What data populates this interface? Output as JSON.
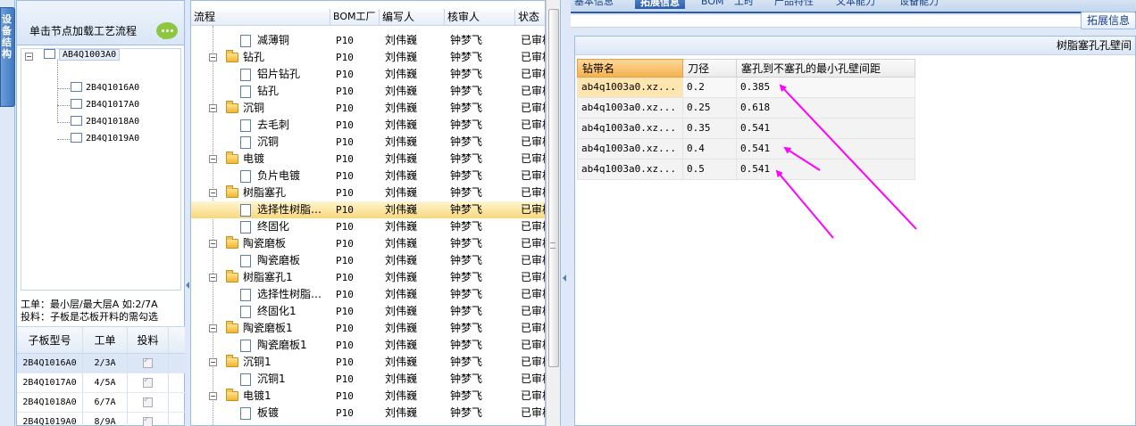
{
  "left_tab": {
    "label": "设备结构"
  },
  "left_panel": {
    "header": "单击节点加载工艺流程",
    "tree": {
      "root": "AB4Q1003A0",
      "children": [
        "2B4Q1016A0",
        "2B4Q1017A0",
        "2B4Q1018A0",
        "2B4Q1019A0"
      ]
    },
    "info_line1": "工单：最小层/最大层A 如:2/7A",
    "info_line2": "投料：子板是芯板开料的需勾选",
    "sub_grid": {
      "headers": [
        "子板型号",
        "工单",
        "投料"
      ],
      "rows": [
        {
          "model": "2B4Q1016A0",
          "order": "2/3A"
        },
        {
          "model": "2B4Q1017A0",
          "order": "4/5A"
        },
        {
          "model": "2B4Q1018A0",
          "order": "6/7A"
        },
        {
          "model": "2B4Q1019A0",
          "order": "8/9A"
        }
      ]
    }
  },
  "process_grid": {
    "headers": [
      "流程",
      "BOM工厂",
      "编写人",
      "核审人",
      "状态"
    ],
    "rows": [
      {
        "name": "减薄铜",
        "level": 2,
        "bom": "P10",
        "writer": "刘伟巍",
        "reviewer": "钟梦飞",
        "status": "已审核"
      },
      {
        "name": "钻孔",
        "level": 1,
        "bom": "P10",
        "writer": "刘伟巍",
        "reviewer": "钟梦飞",
        "status": "已审核"
      },
      {
        "name": "铝片钻孔",
        "level": 2,
        "bom": "P10",
        "writer": "刘伟巍",
        "reviewer": "钟梦飞",
        "status": "已审核"
      },
      {
        "name": "钻孔",
        "level": 2,
        "bom": "P10",
        "writer": "刘伟巍",
        "reviewer": "钟梦飞",
        "status": "已审核"
      },
      {
        "name": "沉铜",
        "level": 1,
        "bom": "P10",
        "writer": "刘伟巍",
        "reviewer": "钟梦飞",
        "status": "已审核"
      },
      {
        "name": "去毛刺",
        "level": 2,
        "bom": "P10",
        "writer": "刘伟巍",
        "reviewer": "钟梦飞",
        "status": "已审核"
      },
      {
        "name": "沉铜",
        "level": 2,
        "bom": "P10",
        "writer": "刘伟巍",
        "reviewer": "钟梦飞",
        "status": "已审核"
      },
      {
        "name": "电镀",
        "level": 1,
        "bom": "P10",
        "writer": "刘伟巍",
        "reviewer": "钟梦飞",
        "status": "已审核"
      },
      {
        "name": "负片电镀",
        "level": 2,
        "bom": "P10",
        "writer": "刘伟巍",
        "reviewer": "钟梦飞",
        "status": "已审核"
      },
      {
        "name": "树脂塞孔",
        "level": 1,
        "bom": "P10",
        "writer": "刘伟巍",
        "reviewer": "钟梦飞",
        "status": "已审核"
      },
      {
        "name": "选择性树脂…",
        "level": 2,
        "bom": "P10",
        "writer": "刘伟巍",
        "reviewer": "钟梦飞",
        "status": "已审核",
        "selected": true
      },
      {
        "name": "终固化",
        "level": 2,
        "bom": "P10",
        "writer": "刘伟巍",
        "reviewer": "钟梦飞",
        "status": "已审核"
      },
      {
        "name": "陶瓷磨板",
        "level": 1,
        "bom": "P10",
        "writer": "刘伟巍",
        "reviewer": "钟梦飞",
        "status": "已审核"
      },
      {
        "name": "陶瓷磨板",
        "level": 2,
        "bom": "P10",
        "writer": "刘伟巍",
        "reviewer": "钟梦飞",
        "status": "已审核"
      },
      {
        "name": "树脂塞孔1",
        "level": 1,
        "bom": "P10",
        "writer": "刘伟巍",
        "reviewer": "钟梦飞",
        "status": "已审核"
      },
      {
        "name": "选择性树脂…",
        "level": 2,
        "bom": "P10",
        "writer": "刘伟巍",
        "reviewer": "钟梦飞",
        "status": "已审核"
      },
      {
        "name": "终固化1",
        "level": 2,
        "bom": "P10",
        "writer": "刘伟巍",
        "reviewer": "钟梦飞",
        "status": "已审核"
      },
      {
        "name": "陶瓷磨板1",
        "level": 1,
        "bom": "P10",
        "writer": "刘伟巍",
        "reviewer": "钟梦飞",
        "status": "已审核"
      },
      {
        "name": "陶瓷磨板1",
        "level": 2,
        "bom": "P10",
        "writer": "刘伟巍",
        "reviewer": "钟梦飞",
        "status": "已审核"
      },
      {
        "name": "沉铜1",
        "level": 1,
        "bom": "P10",
        "writer": "刘伟巍",
        "reviewer": "钟梦飞",
        "status": "已审核"
      },
      {
        "name": "沉铜1",
        "level": 2,
        "bom": "P10",
        "writer": "刘伟巍",
        "reviewer": "钟梦飞",
        "status": "已审核"
      },
      {
        "name": "电镀1",
        "level": 1,
        "bom": "P10",
        "writer": "刘伟巍",
        "reviewer": "钟梦飞",
        "status": "已审核"
      },
      {
        "name": "板镀",
        "level": 2,
        "bom": "P10",
        "writer": "刘伟巍",
        "reviewer": "钟梦飞",
        "status": "已审核"
      }
    ]
  },
  "right_panel": {
    "tabs": [
      "基本信息",
      "拓展信息",
      "BOM",
      "工时",
      "产品特性",
      "文本能力",
      "设备能力"
    ],
    "active_tab": "拓展信息",
    "ext_button": "拓展信息",
    "inner_title": "树脂塞孔孔壁间",
    "grid": {
      "headers": [
        "钻带名",
        "刀径",
        "塞孔到不塞孔的最小孔壁间距"
      ],
      "rows": [
        {
          "name": "ab4q1003a0.xz...",
          "dia": "0.2",
          "dist": "0.385"
        },
        {
          "name": "ab4q1003a0.xz...",
          "dia": "0.25",
          "dist": "0.618"
        },
        {
          "name": "ab4q1003a0.xz...",
          "dia": "0.35",
          "dist": "0.541"
        },
        {
          "name": "ab4q1003a0.xz...",
          "dia": "0.4",
          "dist": "0.541"
        },
        {
          "name": "ab4q1003a0.xz...",
          "dia": "0.5",
          "dist": "0.541"
        }
      ]
    }
  },
  "colors": {
    "annotation_arrow": "#ff00ff",
    "selection": "#f7d87c",
    "accent": "#2a5ca8"
  }
}
